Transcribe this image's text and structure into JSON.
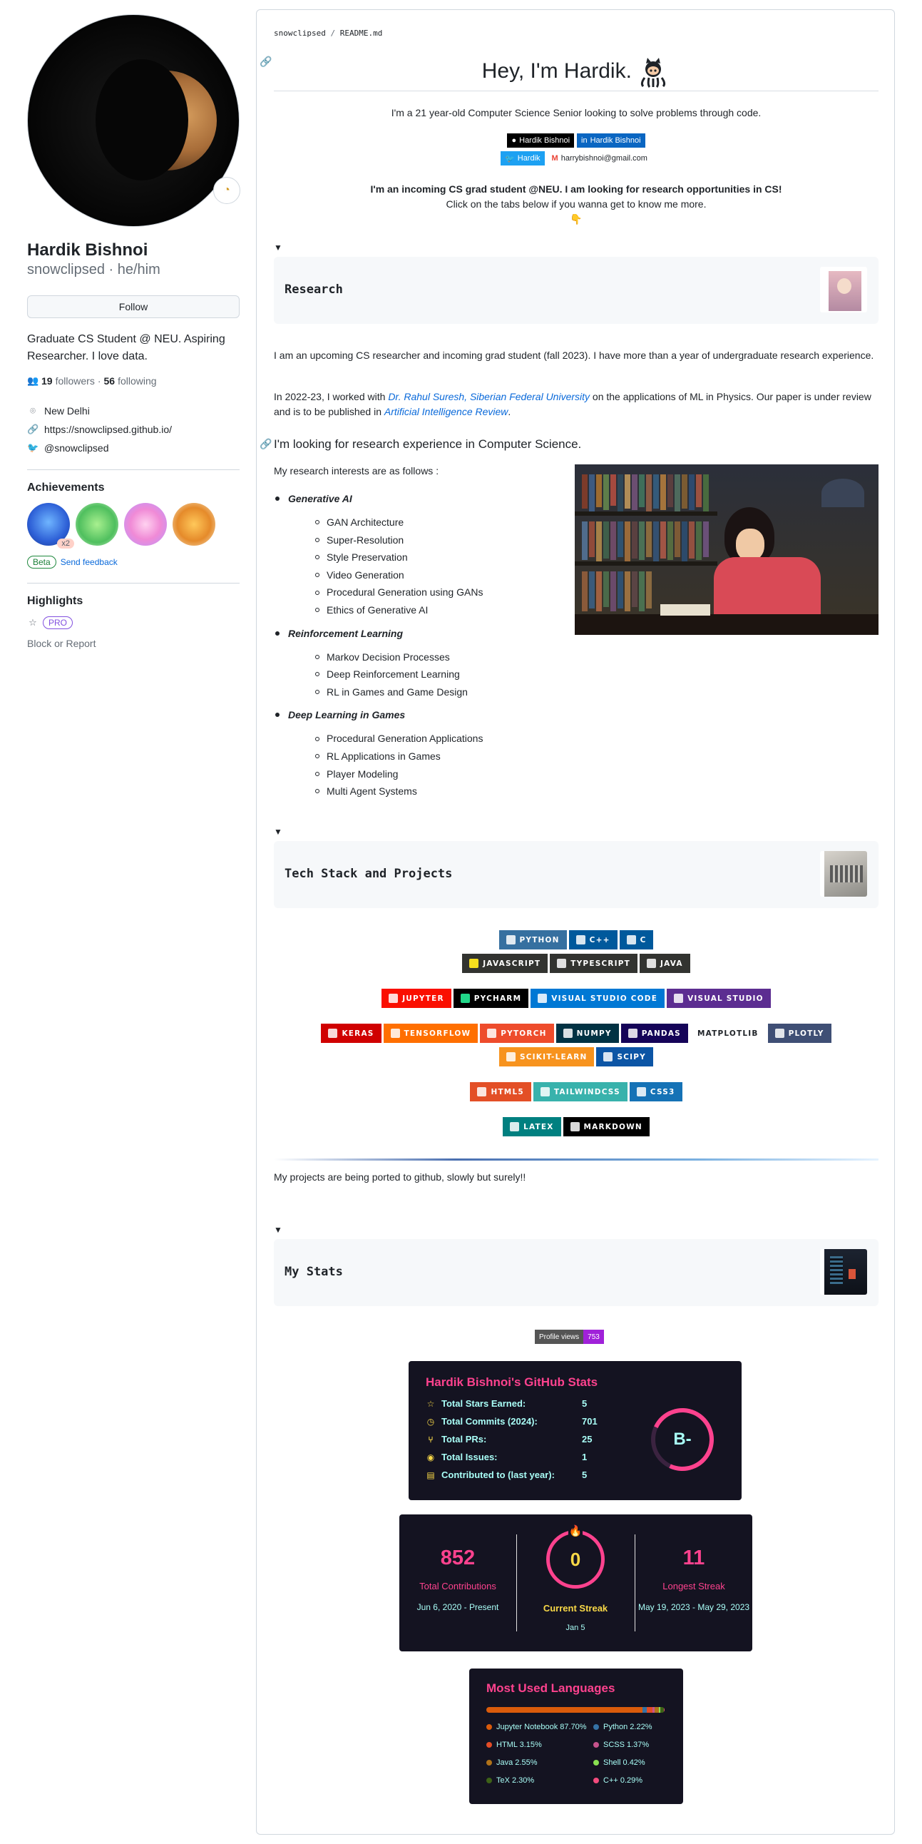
{
  "profile": {
    "fullname": "Hardik Bishnoi",
    "login_line": "snowclipsed · he/him",
    "follow_label": "Follow",
    "bio": "Graduate CS Student @ NEU. Aspiring Researcher. I love data.",
    "followers_count": "19",
    "followers_label": "followers",
    "following_count": "56",
    "following_label": "following",
    "location": "New Delhi",
    "website": "https://snowclipsed.github.io/",
    "twitter": "@snowclipsed",
    "achievements_title": "Achievements",
    "achievement_multiplier": "x2",
    "beta_label": "Beta",
    "feedback_label": "Send feedback",
    "highlights_title": "Highlights",
    "pro_label": "PRO",
    "block_label": "Block or Report"
  },
  "readme": {
    "breadcrumb_user": "snowclipsed",
    "breadcrumb_sep": "/",
    "breadcrumb_file": "README.md",
    "heading": "Hey, I'm Hardik.",
    "intro": "I'm a 21 year-old Computer Science Senior looking to solve problems through code.",
    "shields": {
      "github": "Hardik Bishnoi",
      "linkedin": "Hardik Bishnoi",
      "twitter": "Hardik",
      "email": "harrybishnoi@gmail.com"
    },
    "announce_bold": "I'm an incoming CS grad student @NEU. I am looking for research opportunities in CS!",
    "announce_sub": "Click on the tabs below if you wanna get to know me more.",
    "pointer_emoji": "👇",
    "toggle_marker": "▼",
    "research": {
      "title": "Research",
      "para1": "I am an upcoming CS researcher and incoming grad student (fall 2023). I have more than a year of undergraduate research experience.",
      "para2_pre": "In 2022-23, I worked with ",
      "para2_link": "Dr. Rahul Suresh, Siberian Federal University",
      "para2_mid": " on the applications of ML in Physics. Our paper is under review and is to be published in ",
      "para2_journal": "Artificial Intelligence Review",
      "para2_end": ".",
      "heading": "I'm looking for research experience in Computer Science.",
      "interests_intro": "My research interests are as follows :",
      "categories": [
        {
          "name": "Generative AI",
          "items": [
            "GAN Architecture",
            "Super-Resolution",
            "Style Preservation",
            "Video Generation",
            "Procedural Generation using GANs",
            "Ethics of Generative AI"
          ]
        },
        {
          "name": "Reinforcement Learning",
          "items": [
            "Markov Decision Processes",
            "Deep Reinforcement Learning",
            "RL in Games and Game Design"
          ]
        },
        {
          "name": "Deep Learning in Games",
          "items": [
            "Procedural Generation Applications",
            "RL Applications in Games",
            "Player Modeling",
            "Multi Agent Systems"
          ]
        }
      ]
    },
    "tech": {
      "title": "Tech Stack and Projects",
      "rows": [
        [
          {
            "label": "PYTHON",
            "color": "#3670A0"
          },
          {
            "label": "C++",
            "color": "#00599C"
          },
          {
            "label": "C",
            "color": "#00599C"
          }
        ],
        [
          {
            "label": "JAVASCRIPT",
            "color": "#323330"
          },
          {
            "label": "TYPESCRIPT",
            "color": "#323330"
          },
          {
            "label": "JAVA",
            "color": "#323330"
          }
        ],
        [
          {
            "label": "JUPYTER",
            "color": "#FA0F00"
          },
          {
            "label": "PYCHARM",
            "color": "#000000"
          },
          {
            "label": "VISUAL STUDIO CODE",
            "color": "#0078D4"
          },
          {
            "label": "VISUAL STUDIO",
            "color": "#5C2D91"
          }
        ],
        [
          {
            "label": "KERAS",
            "color": "#D00000"
          },
          {
            "label": "TENSORFLOW",
            "color": "#FF6F00"
          },
          {
            "label": "PYTORCH",
            "color": "#EE4C2C"
          },
          {
            "label": "NUMPY",
            "color": "#013243"
          },
          {
            "label": "PANDAS",
            "color": "#150458"
          },
          {
            "label": "MATPLOTLIB",
            "color": "#ffffff"
          },
          {
            "label": "PLOTLY",
            "color": "#3F4F75"
          }
        ],
        [
          {
            "label": "SCIKIT-LEARN",
            "color": "#F7931E"
          },
          {
            "label": "SCIPY",
            "color": "#0C55A5"
          }
        ],
        [
          {
            "label": "HTML5",
            "color": "#E34F26"
          },
          {
            "label": "TAILWINDCSS",
            "color": "#38B2AC"
          },
          {
            "label": "CSS3",
            "color": "#1572B6"
          }
        ],
        [
          {
            "label": "LATEX",
            "color": "#008080"
          },
          {
            "label": "MARKDOWN",
            "color": "#000000"
          }
        ]
      ],
      "footer": "My projects are being ported to github, slowly but surely!!"
    },
    "stats": {
      "title": "My Stats",
      "views_label": "Profile views",
      "views_value": "753",
      "card_title": "Hardik Bishnoi's GitHub Stats",
      "lines": [
        {
          "label": "Total Stars Earned:",
          "value": "5",
          "icon": "star-icon",
          "glyph": "☆"
        },
        {
          "label": "Total Commits (2024):",
          "value": "701",
          "icon": "history-icon",
          "glyph": "◷"
        },
        {
          "label": "Total PRs:",
          "value": "25",
          "icon": "pull-request-icon",
          "glyph": "⑂"
        },
        {
          "label": "Total Issues:",
          "value": "1",
          "icon": "issue-icon",
          "glyph": "◉"
        },
        {
          "label": "Contributed to (last year):",
          "value": "5",
          "icon": "repo-icon",
          "glyph": "▤"
        }
      ],
      "rank": "B-",
      "streak": {
        "total": "852",
        "total_label": "Total Contributions",
        "total_range": "Jun 6, 2020 - Present",
        "current": "0",
        "current_label": "Current Streak",
        "current_date": "Jan 5",
        "longest": "11",
        "longest_label": "Longest Streak",
        "longest_range": "May 19, 2023 - May 29, 2023"
      },
      "languages_title": "Most Used Languages",
      "languages": [
        {
          "name": "Jupyter Notebook 87.70%",
          "color": "#DA5B0B",
          "pct": 87.7
        },
        {
          "name": "Python 2.22%",
          "color": "#3572A5",
          "pct": 2.22
        },
        {
          "name": "HTML 3.15%",
          "color": "#e34c26",
          "pct": 3.15
        },
        {
          "name": "SCSS 1.37%",
          "color": "#c6538c",
          "pct": 1.37
        },
        {
          "name": "Java 2.55%",
          "color": "#b07219",
          "pct": 2.55
        },
        {
          "name": "Shell 0.42%",
          "color": "#89e051",
          "pct": 0.42
        },
        {
          "name": "TeX 2.30%",
          "color": "#3D6117",
          "pct": 2.3
        },
        {
          "name": "C++ 0.29%",
          "color": "#f34b7d",
          "pct": 0.29
        }
      ]
    }
  }
}
